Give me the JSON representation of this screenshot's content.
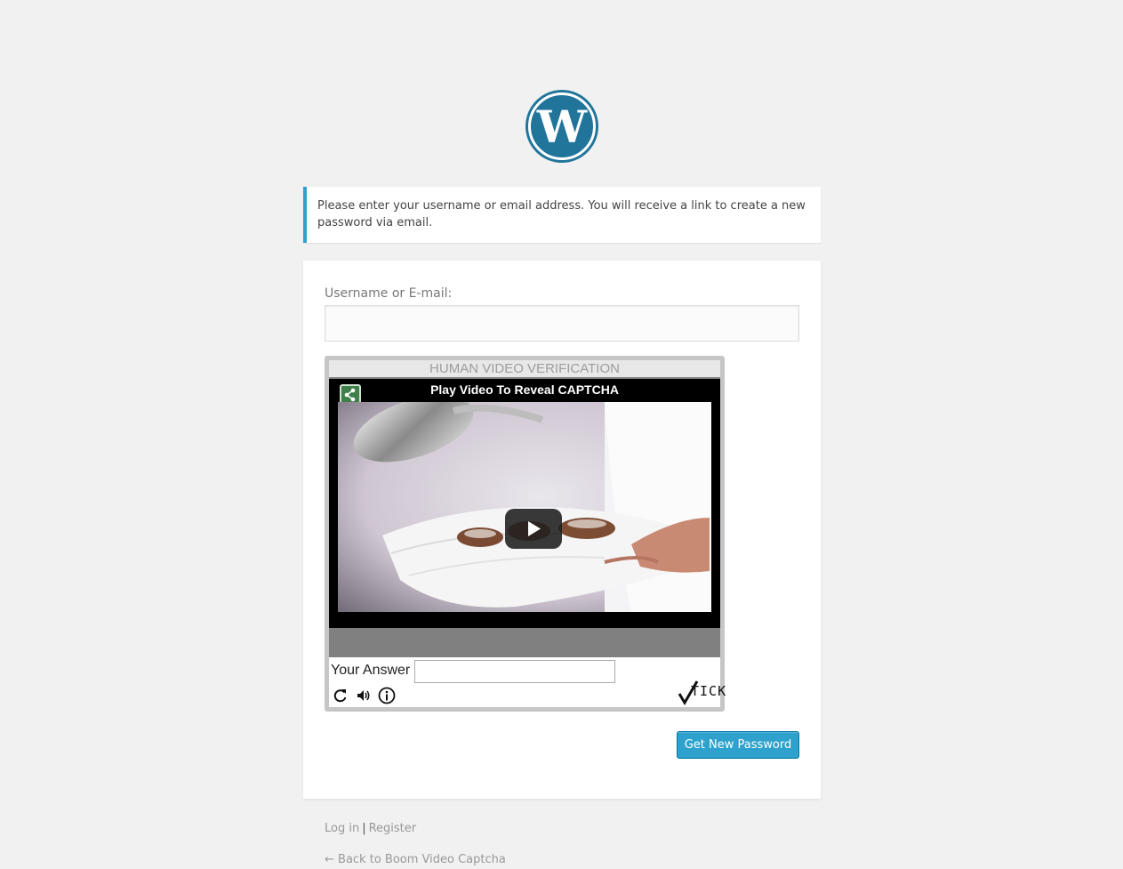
{
  "message": {
    "text": "Please enter your username or email address. You will receive a link to create a new password via email."
  },
  "form": {
    "username_label": "Username or E-mail:",
    "username_value": "",
    "submit_label": "Get New Password"
  },
  "captcha": {
    "title": "HUMAN VIDEO VERIFICATION",
    "video_title": "Play Video To Reveal CAPTCHA",
    "answer_label": "Your Answer",
    "answer_value": "",
    "logo_text": "TICK"
  },
  "nav": {
    "login": "Log in",
    "separator": "|",
    "register": "Register",
    "back": "← Back to Boom Video Captcha"
  },
  "colors": {
    "accent": "#2ea2cc",
    "wp_blue": "#21759b",
    "background": "#f1f1f1"
  },
  "icons": [
    "wordpress-logo",
    "share-icon",
    "play-icon",
    "refresh-icon",
    "audio-icon",
    "info-icon"
  ]
}
